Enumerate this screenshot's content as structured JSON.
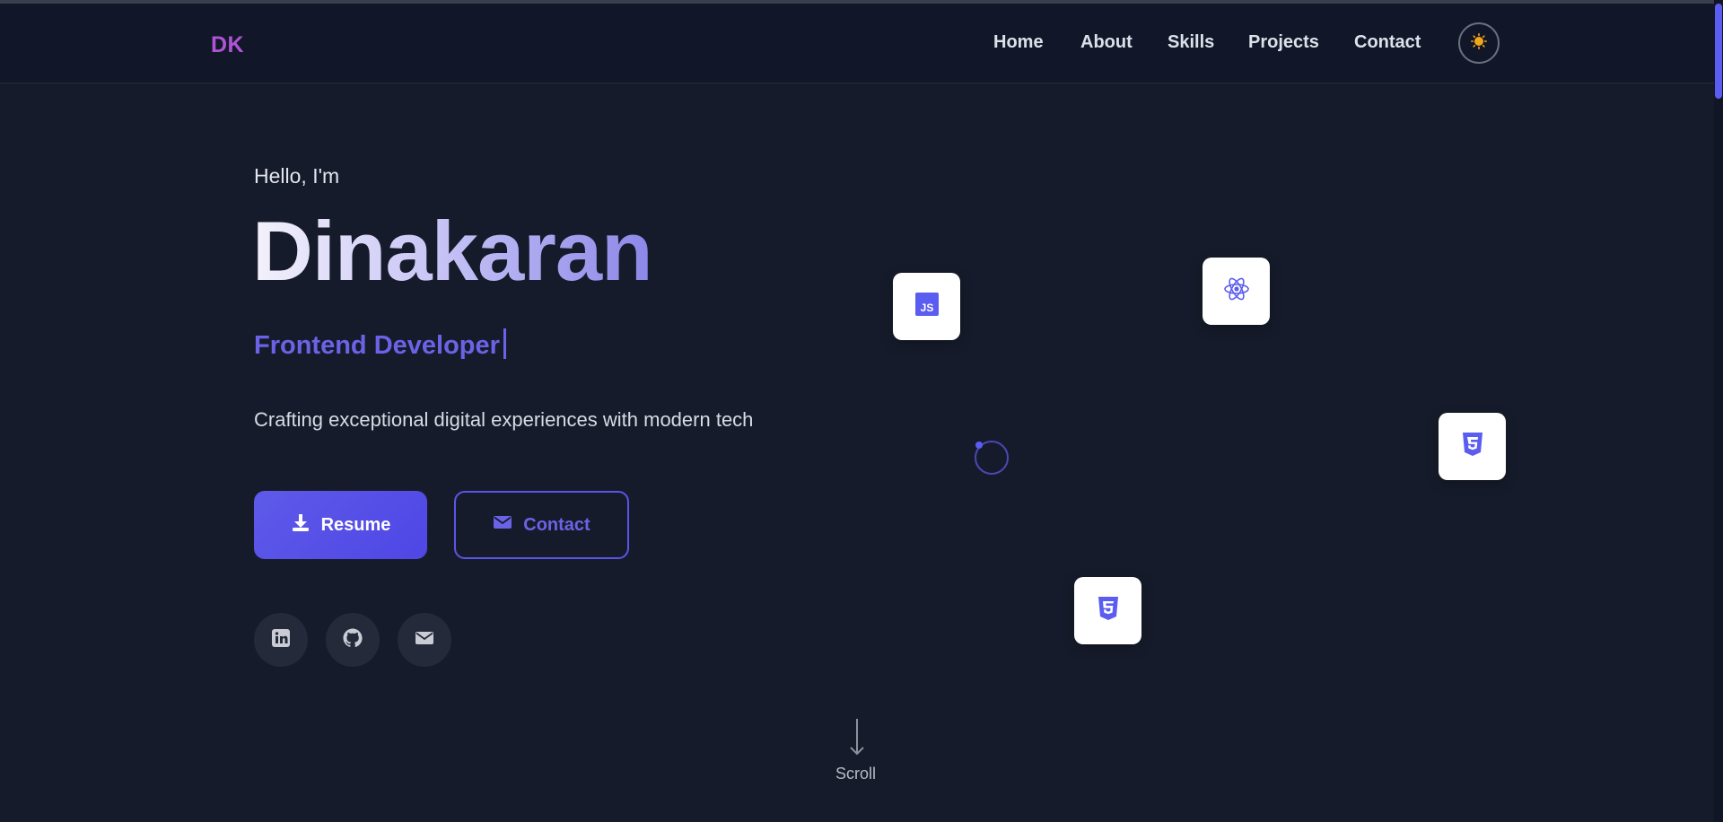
{
  "nav": {
    "logo": "DK",
    "links": [
      "Home",
      "About",
      "Skills",
      "Projects",
      "Contact"
    ],
    "theme_toggle_icon": "sun-icon"
  },
  "hero": {
    "greeting": "Hello, I'm",
    "name": "Dinakaran",
    "role": "Frontend Developer",
    "tagline": "Crafting exceptional digital experiences with modern tech",
    "resume_label": "Resume",
    "contact_label": "Contact"
  },
  "social": {
    "icons": [
      "linkedin-icon",
      "github-icon",
      "mail-icon"
    ]
  },
  "tech_cards": {
    "icons": [
      "javascript-icon",
      "react-icon",
      "css3-icon",
      "html5-icon"
    ]
  },
  "scroll": {
    "label": "Scroll"
  },
  "colors": {
    "background": "#161b2b",
    "navbar": "#111728",
    "accent": "#5b5df0",
    "logo": "#b054d6",
    "role": "#6b63e6"
  }
}
